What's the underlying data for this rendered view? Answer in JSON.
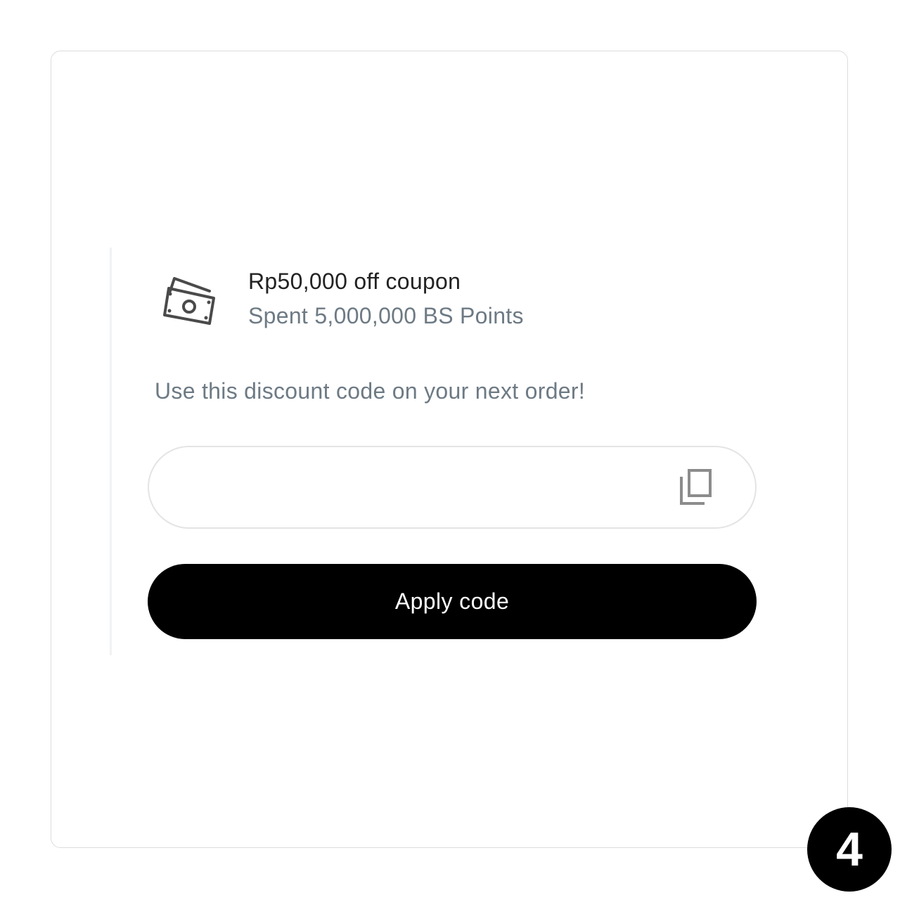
{
  "coupon": {
    "icon": "money-bills-icon",
    "title": "Rp50,000 off coupon",
    "subtitle": "Spent 5,000,000 BS Points"
  },
  "instruction": "Use this discount code on your next order!",
  "code_field": {
    "value": "",
    "copy_icon": "copy-icon"
  },
  "apply_button_label": "Apply code",
  "step_badge": "4",
  "colors": {
    "title": "#222222",
    "muted": "#6d7a84",
    "button_bg": "#000000",
    "button_text": "#ffffff",
    "border": "#e4e4e4"
  }
}
